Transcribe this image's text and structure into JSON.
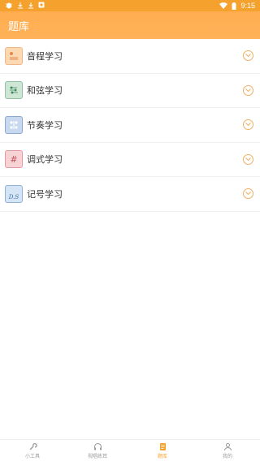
{
  "status_bar": {
    "time": "9:15",
    "icons": [
      "bug-icon",
      "download-icon",
      "download-icon",
      "app-square-icon",
      "wifi-icon",
      "battery-icon"
    ]
  },
  "header": {
    "title": "题库"
  },
  "list": {
    "items": [
      {
        "label": "音程学习",
        "icon": "interval-icon",
        "color": "#fcd9b3"
      },
      {
        "label": "和弦学习",
        "icon": "chord-icon",
        "color": "#cfe6d6"
      },
      {
        "label": "节奏学习",
        "icon": "rhythm-icon",
        "color": "#c8d8ee"
      },
      {
        "label": "调式学习",
        "icon": "sharp-icon",
        "color": "#f8d3d6",
        "symbol": "#"
      },
      {
        "label": "记号学习",
        "icon": "notation-icon",
        "color": "#d5e5f5",
        "symbol": "D.S"
      }
    ]
  },
  "bottom_nav": {
    "items": [
      {
        "label": "小工具",
        "icon": "wrench-icon"
      },
      {
        "label": "视唱练耳",
        "icon": "headphones-icon"
      },
      {
        "label": "题库",
        "icon": "book-icon",
        "active": true
      },
      {
        "label": "我的",
        "icon": "person-icon"
      }
    ]
  },
  "colors": {
    "accent": "#f5a12e",
    "header": "#ffaf55"
  }
}
